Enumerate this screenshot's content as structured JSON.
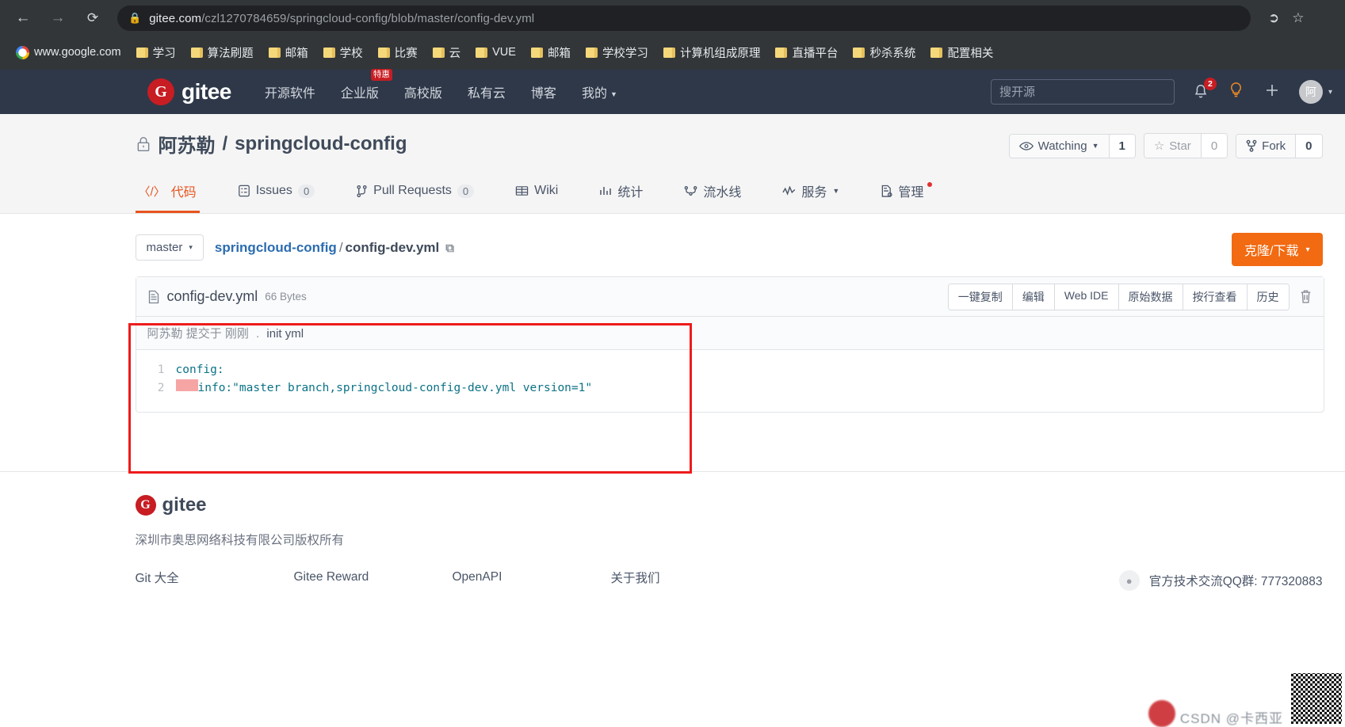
{
  "browser": {
    "back_icon": "back-arrow-icon",
    "forward_icon": "forward-arrow-icon",
    "reload_icon": "reload-icon",
    "lock_icon": "lock-icon",
    "url_domain": "gitee.com",
    "url_path": "/czl1270784659/springcloud-config/blob/master/config-dev.yml",
    "share_icon": "share-icon",
    "star_icon": "bookmark-star-icon",
    "bookmarks": [
      {
        "label": "www.google.com",
        "icon": "google-icon"
      },
      {
        "label": "学习",
        "icon": "folder-icon"
      },
      {
        "label": "算法刷题",
        "icon": "folder-icon"
      },
      {
        "label": "邮箱",
        "icon": "folder-icon"
      },
      {
        "label": "学校",
        "icon": "folder-icon"
      },
      {
        "label": "比赛",
        "icon": "folder-icon"
      },
      {
        "label": "云",
        "icon": "folder-icon"
      },
      {
        "label": "VUE",
        "icon": "folder-icon"
      },
      {
        "label": "邮箱",
        "icon": "folder-icon"
      },
      {
        "label": "学校学习",
        "icon": "folder-icon"
      },
      {
        "label": "计算机组成原理",
        "icon": "folder-icon"
      },
      {
        "label": "直播平台",
        "icon": "folder-icon"
      },
      {
        "label": "秒杀系统",
        "icon": "folder-icon"
      },
      {
        "label": "配置相关",
        "icon": "folder-icon"
      }
    ]
  },
  "site_header": {
    "brand": "gitee",
    "brand_mark": "G",
    "nav": [
      {
        "label": "开源软件"
      },
      {
        "label": "企业版",
        "badge": "特惠"
      },
      {
        "label": "高校版"
      },
      {
        "label": "私有云"
      },
      {
        "label": "博客"
      },
      {
        "label": "我的",
        "caret": true
      }
    ],
    "search_placeholder": "搜开源",
    "notification_count": "2",
    "bell_icon": "bell-icon",
    "idea_icon": "lightbulb-icon",
    "plus_icon": "plus-icon",
    "avatar_text": "阿",
    "avatar_caret": "▾"
  },
  "repo": {
    "lock_icon": "lock-icon",
    "owner": "阿苏勒",
    "separator": "/",
    "name": "springcloud-config",
    "watching_label": "Watching",
    "watching_count": "1",
    "watching_icon": "eye-icon",
    "star_label": "Star",
    "star_count": "0",
    "star_icon": "star-icon",
    "fork_label": "Fork",
    "fork_count": "0",
    "fork_icon": "fork-icon",
    "tabs": [
      {
        "label": "代码",
        "icon": "code-icon",
        "count": null,
        "active": true
      },
      {
        "label": "Issues",
        "icon": "issues-icon",
        "count": "0",
        "active": false
      },
      {
        "label": "Pull Requests",
        "icon": "pull-request-icon",
        "count": "0",
        "active": false
      },
      {
        "label": "Wiki",
        "icon": "wiki-icon",
        "count": null,
        "active": false
      },
      {
        "label": "统计",
        "icon": "chart-icon",
        "count": null,
        "active": false
      },
      {
        "label": "流水线",
        "icon": "pipeline-icon",
        "count": null,
        "active": false
      },
      {
        "label": "服务",
        "icon": "service-icon",
        "count": null,
        "active": false,
        "caret": true
      },
      {
        "label": "管理",
        "icon": "manage-icon",
        "count": null,
        "active": false,
        "dot": true
      }
    ]
  },
  "file_view": {
    "branch": "master",
    "branch_caret": "▾",
    "breadcrumb_repo": "springcloud-config",
    "breadcrumb_slash": "/",
    "breadcrumb_file": "config-dev.yml",
    "copy_path_icon": "copy-icon",
    "clone_label": "克隆/下载",
    "clone_caret": "▾",
    "file_icon": "file-icon",
    "file_name": "config-dev.yml",
    "file_size": "66 Bytes",
    "tools": [
      "一键复制",
      "编辑",
      "Web IDE",
      "原始数据",
      "按行查看",
      "历史"
    ],
    "delete_icon": "trash-icon",
    "commit_author": "阿苏勒",
    "commit_verb": "提交于",
    "commit_time": "刚刚",
    "commit_dot": ".",
    "commit_message": "init yml",
    "code_lines": [
      {
        "no": "1",
        "indent": 0,
        "text": "config:",
        "type": "key"
      },
      {
        "no": "2",
        "indent": 1,
        "text": "info:\"master branch,springcloud-config-dev.yml version=1\"",
        "type": "kv"
      }
    ]
  },
  "footer": {
    "brand_mark": "G",
    "brand": "gitee",
    "copyright": "深圳市奥思网络科技有限公司版权所有",
    "links": [
      "Git 大全",
      "Gitee Reward",
      "OpenAPI",
      "关于我们"
    ],
    "qq_icon": "qq-icon",
    "qq_text": "官方技术交流QQ群: 777320883"
  },
  "watermark": {
    "text": "CSDN @卡西亚"
  }
}
